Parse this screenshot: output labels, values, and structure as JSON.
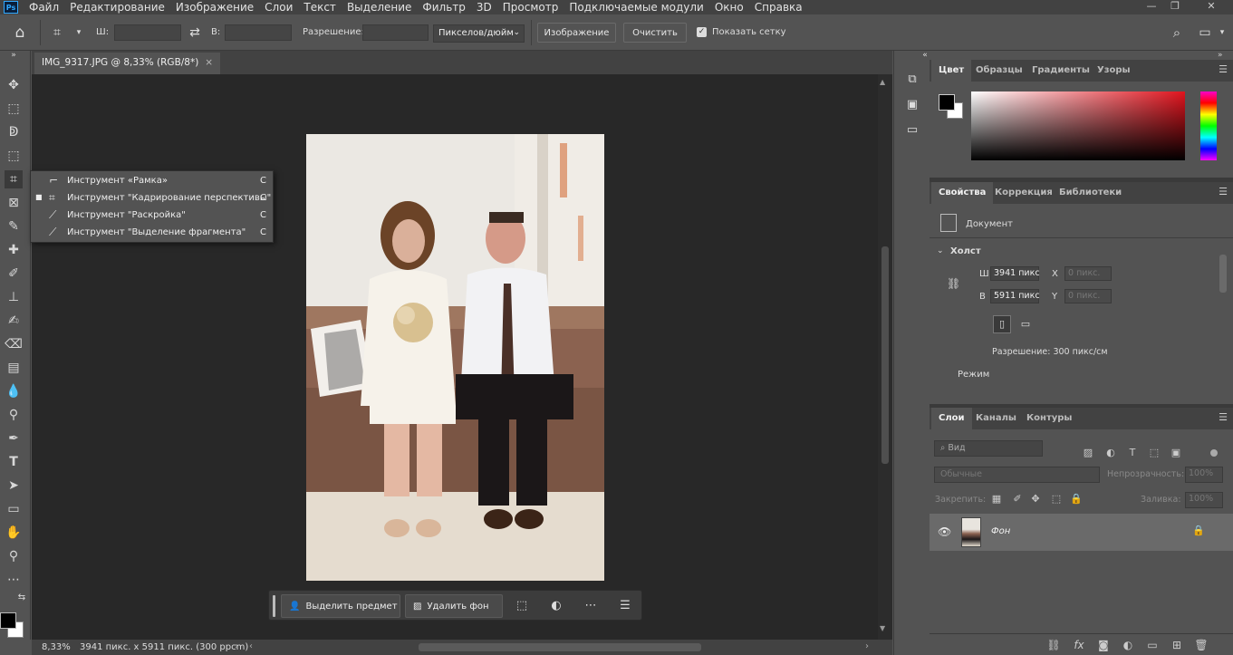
{
  "app": {
    "logo": "Ps"
  },
  "menu": [
    "Файл",
    "Редактирование",
    "Изображение",
    "Слои",
    "Текст",
    "Выделение",
    "Фильтр",
    "3D",
    "Просмотр",
    "Подключаемые модули",
    "Окно",
    "Справка"
  ],
  "window_controls": {
    "minimize": "—",
    "restore": "❐",
    "close": "✕"
  },
  "options": {
    "width_label": "Ш:",
    "width_value": "",
    "height_label": "В:",
    "resolution_label": "Разрешение:",
    "resolution_value": "",
    "units": "Пикселов/дюйм",
    "image_button": "Изображение",
    "clear_button": "Очистить",
    "show_grid_label": "Показать сетку",
    "show_grid_checked": true
  },
  "document": {
    "tab_title": "IMG_9317.JPG @ 8,33% (RGB/8*)",
    "zoom": "8,33%",
    "status": "3941 пикс. x 5911 пикс. (300 ppcm)"
  },
  "flyout": [
    {
      "label": "Инструмент «Рамка»",
      "key": "C",
      "icon": "crop-icon",
      "selected": false
    },
    {
      "label": "Инструмент \"Кадрирование перспективы\"",
      "key": "C",
      "icon": "perspective-crop-icon",
      "selected": true
    },
    {
      "label": "Инструмент \"Раскройка\"",
      "key": "C",
      "icon": "slice-icon",
      "selected": false
    },
    {
      "label": "Инструмент \"Выделение фрагмента\"",
      "key": "C",
      "icon": "slice-select-icon",
      "selected": false
    }
  ],
  "taskbar": {
    "select_subject": "Выделить предмет",
    "remove_bg": "Удалить фон"
  },
  "color_panel": {
    "tabs": [
      "Цвет",
      "Образцы",
      "Градиенты",
      "Узоры"
    ],
    "foreground": "#000000",
    "background": "#ffffff"
  },
  "properties_panel": {
    "tabs": [
      "Свойства",
      "Коррекция",
      "Библиотеки"
    ],
    "doc_label": "Документ",
    "canvas_header": "Холст",
    "w_label": "Ш",
    "w_value": "3941 пикс",
    "h_label": "В",
    "h_value": "5911 пикс",
    "x_label": "X",
    "x_value": "0 пикс.",
    "y_label": "Y",
    "y_value": "0 пикс.",
    "resolution": "Разрешение: 300 пикс/см",
    "mode_label": "Режим"
  },
  "layers_panel": {
    "tabs": [
      "Слои",
      "Каналы",
      "Контуры"
    ],
    "search_placeholder": "Вид",
    "blend_mode": "Обычные",
    "opacity_label": "Непрозрачность:",
    "opacity_value": "100%",
    "lock_label": "Закрепить:",
    "fill_label": "Заливка:",
    "fill_value": "100%",
    "layer_name": "Фон"
  }
}
